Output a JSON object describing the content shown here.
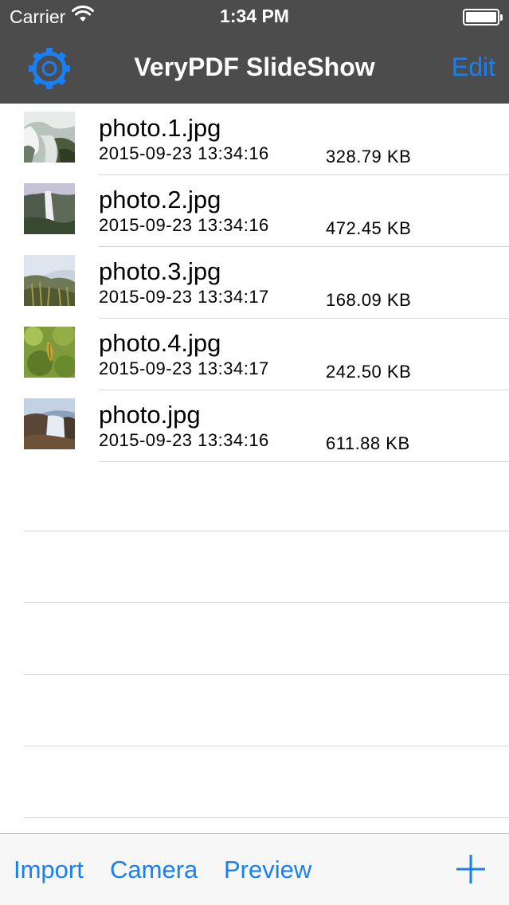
{
  "status_bar": {
    "carrier": "Carrier",
    "time": "1:34 PM",
    "wifi_icon": "wifi-icon",
    "battery_icon": "battery-icon"
  },
  "nav_bar": {
    "title": "VeryPDF SlideShow",
    "settings_icon": "gear-icon",
    "edit_label": "Edit"
  },
  "files": [
    {
      "name": "photo.1.jpg",
      "date": "2015-09-23 13:34:16",
      "size": "328.79 KB"
    },
    {
      "name": "photo.2.jpg",
      "date": "2015-09-23 13:34:16",
      "size": "472.45 KB"
    },
    {
      "name": "photo.3.jpg",
      "date": "2015-09-23 13:34:17",
      "size": "168.09 KB"
    },
    {
      "name": "photo.4.jpg",
      "date": "2015-09-23 13:34:17",
      "size": "242.50 KB"
    },
    {
      "name": "photo.jpg",
      "date": "2015-09-23 13:34:16",
      "size": "611.88 KB"
    }
  ],
  "toolbar": {
    "import_label": "Import",
    "camera_label": "Camera",
    "preview_label": "Preview",
    "add_icon": "plus-icon"
  },
  "colors": {
    "accent": "#1a7ff5",
    "bar_background": "#4c4c4c"
  }
}
